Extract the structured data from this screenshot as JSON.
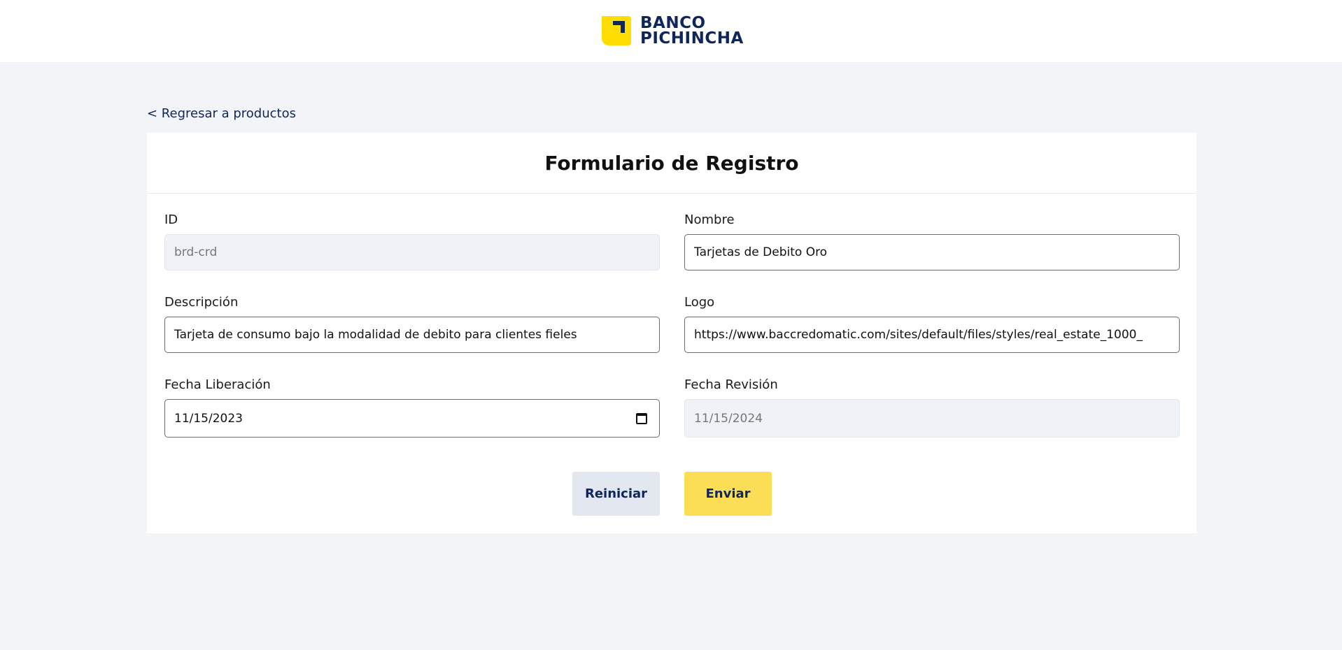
{
  "header": {
    "logo_line1": "BANCO",
    "logo_line2": "PICHINCHA",
    "brand_color": "#0f265c",
    "accent_color": "#ffdd00",
    "logo_icon": "banco-pichincha-logo-icon"
  },
  "nav": {
    "back_label": "< Regresar a productos"
  },
  "form": {
    "title": "Formulario de Registro",
    "fields": {
      "id": {
        "label": "ID",
        "value": "brd-crd",
        "disabled": true
      },
      "name": {
        "label": "Nombre",
        "value": "Tarjetas de Debito Oro"
      },
      "description": {
        "label": "Descripción",
        "value": "Tarjeta de consumo bajo la modalidad de debito para clientes fieles"
      },
      "logo": {
        "label": "Logo",
        "value": "https://www.baccredomatic.com/sites/default/files/styles/real_estate_1000_"
      },
      "release_date": {
        "label": "Fecha Liberación",
        "value": "11/15/2023",
        "icon": "calendar-icon"
      },
      "revision_date": {
        "label": "Fecha Revisión",
        "value": "11/15/2024",
        "disabled": true
      }
    },
    "buttons": {
      "reset_label": "Reiniciar",
      "submit_label": "Enviar",
      "submit_color": "#fbde56",
      "reset_color": "#e2e7f0"
    }
  }
}
